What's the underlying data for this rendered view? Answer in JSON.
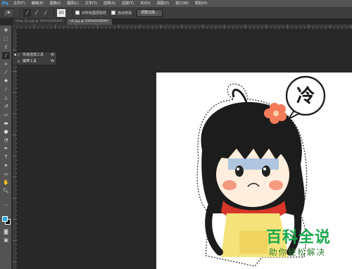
{
  "app": {
    "logo": "Ps"
  },
  "menu": [
    "文件(F)",
    "编辑(E)",
    "图像(I)",
    "图层(L)",
    "文字(Y)",
    "选择(S)",
    "滤镜(T)",
    "3D(D)",
    "视图(V)",
    "窗口(W)",
    "帮助(H)"
  ],
  "options": {
    "brush_size": "30",
    "sample_all_layers": "对所有图层取样",
    "auto_enhance": "自动增强",
    "refine_edge": "调整边缘..."
  },
  "tabs": [
    {
      "label": "timg (3).jpg @ 100%(RGB/8#)",
      "active": false
    },
    {
      "label": "u4.jpg @ 100%(RGB/8#)",
      "active": true
    }
  ],
  "flyout": {
    "items": [
      {
        "label": "快速选择工具",
        "key": "W",
        "selected": true
      },
      {
        "label": "魔棒工具",
        "key": "W",
        "selected": false
      }
    ]
  },
  "ruler": [
    "0",
    "50",
    "100",
    "150",
    "200",
    "250",
    "300",
    "350",
    "400",
    "450",
    "500",
    "550",
    "600",
    "650",
    "700",
    "750",
    "800"
  ],
  "swatches": {
    "foreground": "#29a9e1",
    "background": "#000000"
  },
  "artwork": {
    "speech_bubble_text": "冷"
  },
  "watermark": {
    "title": "百科全说",
    "subtitle": "助你轻松解决"
  }
}
